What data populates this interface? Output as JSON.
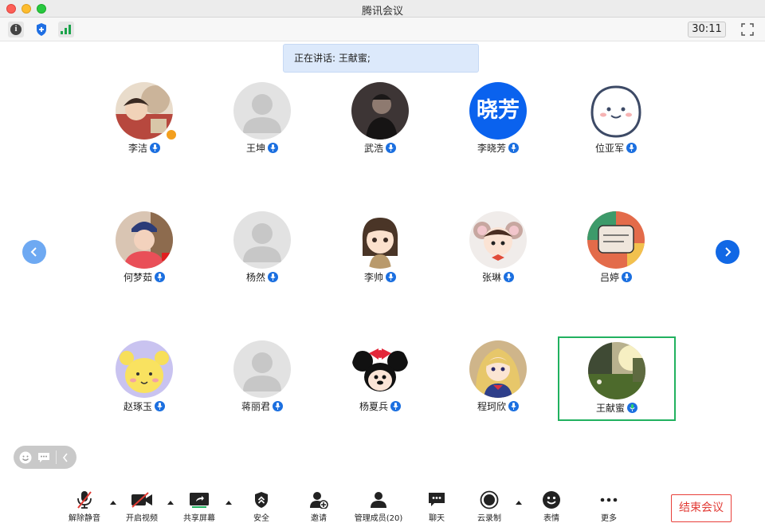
{
  "window": {
    "title": "腾讯会议"
  },
  "toolbar": {
    "timer": "30:11"
  },
  "banner": {
    "speaking": "正在讲话: 王献蜜;"
  },
  "participants": [
    {
      "name": "李洁"
    },
    {
      "name": "王坤"
    },
    {
      "name": "武浩"
    },
    {
      "name": "李晓芳",
      "avatar_text": "晓芳"
    },
    {
      "name": "位亚军"
    },
    {
      "name": "何梦茹"
    },
    {
      "name": "杨然"
    },
    {
      "name": "李帅"
    },
    {
      "name": "张琳"
    },
    {
      "name": "吕婷"
    },
    {
      "name": "赵琢玉"
    },
    {
      "name": "蒋丽君"
    },
    {
      "name": "杨夏兵"
    },
    {
      "name": "程珂欣"
    },
    {
      "name": "王献蜜"
    }
  ],
  "bottom": {
    "unmute": "解除静音",
    "video": "开启视频",
    "share": "共享屏幕",
    "security": "安全",
    "invite": "邀请",
    "members": "管理成员(20)",
    "chat": "聊天",
    "record": "云录制",
    "reactions": "表情",
    "more": "更多",
    "end": "结束会议"
  },
  "colors": {
    "accent": "#1168e5",
    "active_border": "#21b15f",
    "end": "#e23b35"
  }
}
